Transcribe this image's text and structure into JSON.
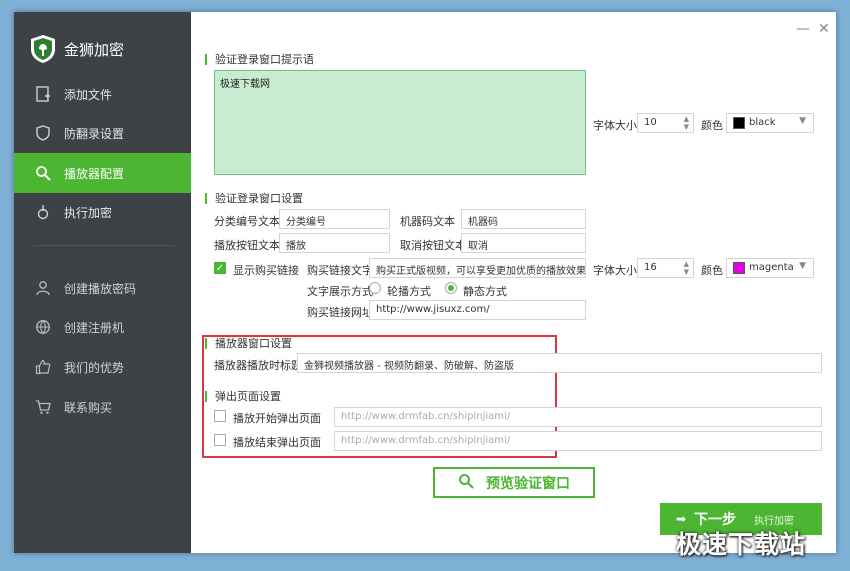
{
  "app": {
    "name": "金狮加密"
  },
  "sidebar": {
    "items": [
      {
        "label": "添加文件",
        "icon": "add-file-icon"
      },
      {
        "label": "防翻录设置",
        "icon": "shield-icon"
      },
      {
        "label": "播放器配置",
        "icon": "search-icon",
        "active": true
      },
      {
        "label": "执行加密",
        "icon": "run-icon"
      },
      {
        "label": "创建播放密码",
        "icon": "user-icon"
      },
      {
        "label": "创建注册机",
        "icon": "globe-icon"
      },
      {
        "label": "我们的优势",
        "icon": "thumbs-up-icon"
      },
      {
        "label": "联系购买",
        "icon": "cart-icon"
      }
    ]
  },
  "window": {
    "minimize": "—",
    "close": "✕"
  },
  "login_prompt": {
    "title": "验证登录窗口提示语",
    "text": "极速下载网",
    "font_size_label": "字体大小",
    "font_size": "10",
    "color_label": "颜色",
    "color_name": "black",
    "color_hex": "#000000"
  },
  "login_settings": {
    "title": "验证登录窗口设置",
    "category_label": "分类编号文本",
    "category_value": "分类编号",
    "machine_label": "机器码文本",
    "machine_value": "机器码",
    "play_btn_label": "播放按钮文本",
    "play_btn_value": "播放",
    "cancel_btn_label": "取消按钮文本",
    "cancel_btn_value": "取消",
    "show_buy_label": "显示购买链接",
    "show_buy_checked": true,
    "buy_text_label": "购买链接文字",
    "buy_text_value": "购买正式版视频，可以享受更加优质的播放效果",
    "font_size_label": "字体大小",
    "font_size": "16",
    "color_label": "颜色",
    "color_name": "magenta",
    "color_hex": "#e600e6",
    "display_mode_label": "文字展示方式",
    "mode_scroll": "轮播方式",
    "mode_static": "静态方式",
    "selected_mode": "静态方式",
    "buy_url_label": "购买链接网址",
    "buy_url_value": "http://www.jisuxz.com/"
  },
  "player_window": {
    "title": "播放器窗口设置",
    "play_title_label": "播放器播放时标题",
    "play_title_value": "金狮视频播放器 - 视频防翻录、防破解、防盗版"
  },
  "popup": {
    "title": "弹出页面设置",
    "start_label": "播放开始弹出页面",
    "start_placeholder": "http://www.drmfab.cn/shipinjiami/",
    "end_label": "播放结束弹出页面",
    "end_placeholder": "http://www.drmfab.cn/shipinjiami/"
  },
  "buttons": {
    "preview": "预览验证窗口",
    "next": "下一步",
    "next_sub": "执行加密"
  },
  "colors": {
    "accent": "#4cb532",
    "sidebar": "#3f4244",
    "highlight_box": "#d9373f"
  },
  "watermark": "极速下载站"
}
